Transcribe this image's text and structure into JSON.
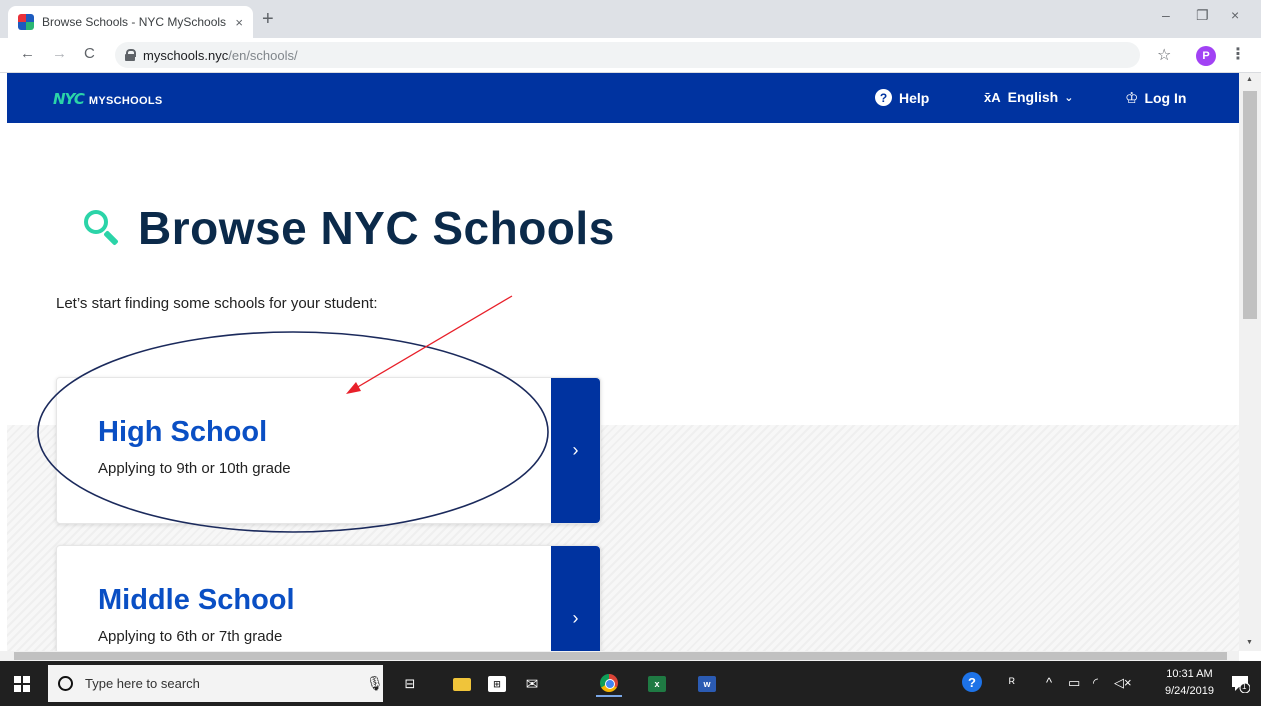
{
  "browser": {
    "tab_title": "Browse Schools - NYC MySchools",
    "tab_close": "×",
    "new_tab": "+",
    "url_host": "myschools.nyc",
    "url_path": "/en/schools/",
    "profile_initial": "P",
    "window_controls": {
      "minimize": "–",
      "restore": "❐",
      "close": "×"
    },
    "nav": {
      "back": "←",
      "forward": "→",
      "reload": "C"
    },
    "star": "☆",
    "menu": "⋮"
  },
  "site": {
    "logo_nyc": "NYC",
    "logo_text": "MYSCHOOLS",
    "header": {
      "help": "Help",
      "help_glyph": "?",
      "language": "English",
      "language_glyph": "x̄A",
      "chevron": "⌄",
      "login": "Log In",
      "login_glyph": "♔"
    },
    "colors": {
      "brand_blue": "#0033a0",
      "accent_teal": "#2bd4a8",
      "heading_blue": "#0a4fc4",
      "annotation_red": "#e8202a",
      "annotation_navy": "#1b2a5c"
    }
  },
  "main": {
    "title": "Browse NYC Schools",
    "lede": "Let’s start finding some schools for your student:",
    "cards": [
      {
        "heading": "High School",
        "subtitle": "Applying to 9th or 10th grade",
        "arrow": "›"
      },
      {
        "heading": "Middle School",
        "subtitle": "Applying to 6th or 7th grade",
        "arrow": "›"
      }
    ]
  },
  "taskbar": {
    "search_placeholder": "Type here to search",
    "apps": [
      "task-view",
      "file-explorer",
      "store",
      "mail",
      "chrome",
      "excel",
      "word"
    ],
    "excel_letter": "x",
    "word_letter": "w",
    "time": "10:31 AM",
    "date": "9/24/2019",
    "notification_count": "1"
  }
}
